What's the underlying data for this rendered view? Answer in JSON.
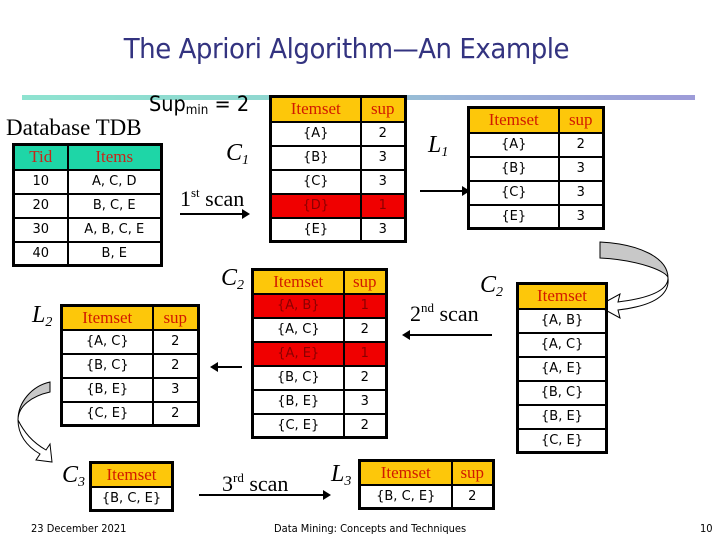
{
  "slide": {
    "title": "The Apriori Algorithm—An Example",
    "title_color": "#333380",
    "header_color": "#fdc70a",
    "header_text_color": "#d21a00",
    "pruned_color": "#f00000"
  },
  "min_support": {
    "label": "Sup",
    "subscript": "min",
    "value": "= 2"
  },
  "database": {
    "label": "Database TDB",
    "columns": [
      "Tid",
      "Items"
    ],
    "rows": [
      [
        "10",
        "A, C, D"
      ],
      [
        "20",
        "B, C, E"
      ],
      [
        "30",
        "A, B, C, E"
      ],
      [
        "40",
        "B, E"
      ]
    ]
  },
  "scans": {
    "first": {
      "num": "1",
      "suffix": "st",
      "word": "scan"
    },
    "second": {
      "num": "2",
      "suffix": "nd",
      "word": "scan"
    },
    "third": {
      "num": "3",
      "suffix": "rd",
      "word": "scan"
    }
  },
  "c1": {
    "label": "C",
    "sub": "1",
    "columns": [
      "Itemset",
      "sup"
    ],
    "rows": [
      {
        "itemset": "{A}",
        "sup": "2",
        "pruned": false
      },
      {
        "itemset": "{B}",
        "sup": "3",
        "pruned": false
      },
      {
        "itemset": "{C}",
        "sup": "3",
        "pruned": false
      },
      {
        "itemset": "{D}",
        "sup": "1",
        "pruned": true
      },
      {
        "itemset": "{E}",
        "sup": "3",
        "pruned": false
      }
    ]
  },
  "l1": {
    "label": "L",
    "sub": "1",
    "columns": [
      "Itemset",
      "sup"
    ],
    "rows": [
      {
        "itemset": "{A}",
        "sup": "2"
      },
      {
        "itemset": "{B}",
        "sup": "3"
      },
      {
        "itemset": "{C}",
        "sup": "3"
      },
      {
        "itemset": "{E}",
        "sup": "3"
      }
    ]
  },
  "c2_candidates": {
    "label": "C",
    "sub": "2",
    "columns": [
      "Itemset"
    ],
    "rows": [
      "{A, B}",
      "{A, C}",
      "{A, E}",
      "{B, C}",
      "{B, E}",
      "{C, E}"
    ]
  },
  "c2_counted": {
    "label": "C",
    "sub": "2",
    "columns": [
      "Itemset",
      "sup"
    ],
    "rows": [
      {
        "itemset": "{A, B}",
        "sup": "1",
        "pruned": true
      },
      {
        "itemset": "{A, C}",
        "sup": "2",
        "pruned": false
      },
      {
        "itemset": "{A, E}",
        "sup": "1",
        "pruned": true
      },
      {
        "itemset": "{B, C}",
        "sup": "2",
        "pruned": false
      },
      {
        "itemset": "{B, E}",
        "sup": "3",
        "pruned": false
      },
      {
        "itemset": "{C, E}",
        "sup": "2",
        "pruned": false
      }
    ]
  },
  "l2": {
    "label": "L",
    "sub": "2",
    "columns": [
      "Itemset",
      "sup"
    ],
    "rows": [
      {
        "itemset": "{A, C}",
        "sup": "2"
      },
      {
        "itemset": "{B, C}",
        "sup": "2"
      },
      {
        "itemset": "{B, E}",
        "sup": "3"
      },
      {
        "itemset": "{C, E}",
        "sup": "2"
      }
    ]
  },
  "c3": {
    "label": "C",
    "sub": "3",
    "columns": [
      "Itemset"
    ],
    "rows": [
      "{B, C, E}"
    ]
  },
  "l3": {
    "label": "L",
    "sub": "3",
    "columns": [
      "Itemset",
      "sup"
    ],
    "rows": [
      {
        "itemset": "{B, C, E}",
        "sup": "2"
      }
    ]
  },
  "footer": {
    "date": "23 December 2021",
    "course": "Data Mining: Concepts and Techniques",
    "page": "10"
  }
}
